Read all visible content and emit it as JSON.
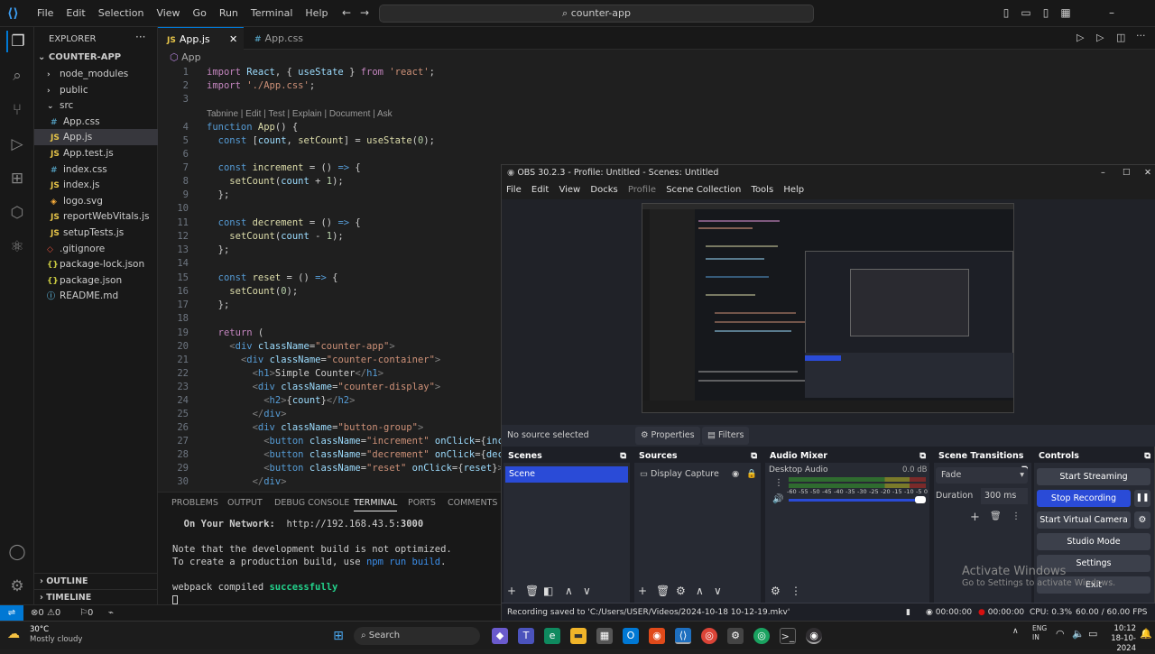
{
  "vscode": {
    "menu": [
      "File",
      "Edit",
      "Selection",
      "View",
      "Go",
      "Run",
      "Terminal",
      "Help"
    ],
    "search": "counter-app",
    "explorer_title": "EXPLORER",
    "root": "COUNTER-APP",
    "tree": [
      {
        "label": "node_modules",
        "type": "folder",
        "depth": 1
      },
      {
        "label": "public",
        "type": "folder",
        "depth": 1
      },
      {
        "label": "src",
        "type": "folder-open",
        "depth": 1
      },
      {
        "label": "App.css",
        "type": "css",
        "depth": 2
      },
      {
        "label": "App.js",
        "type": "js",
        "depth": 2,
        "selected": true
      },
      {
        "label": "App.test.js",
        "type": "js",
        "depth": 2
      },
      {
        "label": "index.css",
        "type": "css",
        "depth": 2
      },
      {
        "label": "index.js",
        "type": "js",
        "depth": 2
      },
      {
        "label": "logo.svg",
        "type": "svg",
        "depth": 2
      },
      {
        "label": "reportWebVitals.js",
        "type": "js",
        "depth": 2
      },
      {
        "label": "setupTests.js",
        "type": "js",
        "depth": 2
      },
      {
        "label": ".gitignore",
        "type": "git",
        "depth": 1
      },
      {
        "label": "package-lock.json",
        "type": "json",
        "depth": 1
      },
      {
        "label": "package.json",
        "type": "json",
        "depth": 1
      },
      {
        "label": "README.md",
        "type": "md",
        "depth": 1
      }
    ],
    "tabs": [
      {
        "label": "App.js",
        "icon": "JS",
        "active": true
      },
      {
        "label": "App.css",
        "icon": "#",
        "active": false
      }
    ],
    "breadcrumb": "App",
    "codelens": "Tabnine | Edit | Test | Explain | Document | Ask",
    "line_numbers": [
      "1",
      "2",
      "3",
      "4",
      "5",
      "6",
      "7",
      "8",
      "9",
      "10",
      "11",
      "12",
      "13",
      "14",
      "15",
      "16",
      "17",
      "18",
      "19",
      "20",
      "21",
      "22",
      "23",
      "24",
      "25",
      "26",
      "27",
      "28",
      "29",
      "30"
    ],
    "panel_tabs": [
      "PROBLEMS",
      "OUTPUT",
      "DEBUG CONSOLE",
      "TERMINAL",
      "PORTS",
      "COMMENTS"
    ],
    "terminal": {
      "network_label": "On Your Network:",
      "network_url": "http://192.168.43.5:",
      "network_port": "3000",
      "note1": "Note that the development build is not optimized.",
      "note2a": "To create a production build, use ",
      "note2b": "npm run build",
      "note2c": ".",
      "compiled_a": "webpack compiled ",
      "compiled_b": "successfully"
    },
    "outline": "OUTLINE",
    "timeline": "TIMELINE",
    "status": {
      "errors": "0",
      "warnings": "0",
      "ports": "0"
    }
  },
  "obs": {
    "title": "OBS 30.2.3 - Profile: Untitled - Scenes: Untitled",
    "menu": [
      "File",
      "Edit",
      "View",
      "Docks",
      "Profile",
      "Scene Collection",
      "Tools",
      "Help"
    ],
    "no_source": "No source selected",
    "properties": "Properties",
    "filters": "Filters",
    "docks": {
      "scenes": "Scenes",
      "sources": "Sources",
      "audio": "Audio Mixer",
      "transitions": "Scene Transitions",
      "controls": "Controls"
    },
    "scene_item": "Scene",
    "source_item": "Display Capture",
    "audio": {
      "name": "Desktop Audio",
      "level": "0.0 dB",
      "ticks": [
        "-60",
        "-55",
        "-50",
        "-45",
        "-40",
        "-35",
        "-30",
        "-25",
        "-20",
        "-15",
        "-10",
        "-5",
        "0"
      ]
    },
    "transition": {
      "type": "Fade",
      "duration_label": "Duration",
      "duration": "300 ms"
    },
    "controls": [
      "Start Streaming",
      "Stop Recording",
      "Start Virtual Camera",
      "Studio Mode",
      "Settings",
      "Exit"
    ],
    "status": {
      "saved": "Recording saved to 'C:/Users/USER/Videos/2024-10-18 10-12-19.mkv'",
      "stream_time": "00:00:00",
      "rec_time": "00:00:00",
      "cpu": "CPU: 0.3%",
      "fps": "60.00 / 60.00 FPS"
    },
    "colors": {
      "accent": "#2a4bd7",
      "rec": "#d51010"
    }
  },
  "watermark": {
    "title": "Activate Windows",
    "sub": "Go to Settings to activate Windows."
  },
  "taskbar": {
    "temp": "30°C",
    "weather": "Mostly cloudy",
    "search": "Search",
    "lang1": "ENG",
    "lang2": "IN",
    "time": "10:12",
    "date": "18-10-2024"
  }
}
